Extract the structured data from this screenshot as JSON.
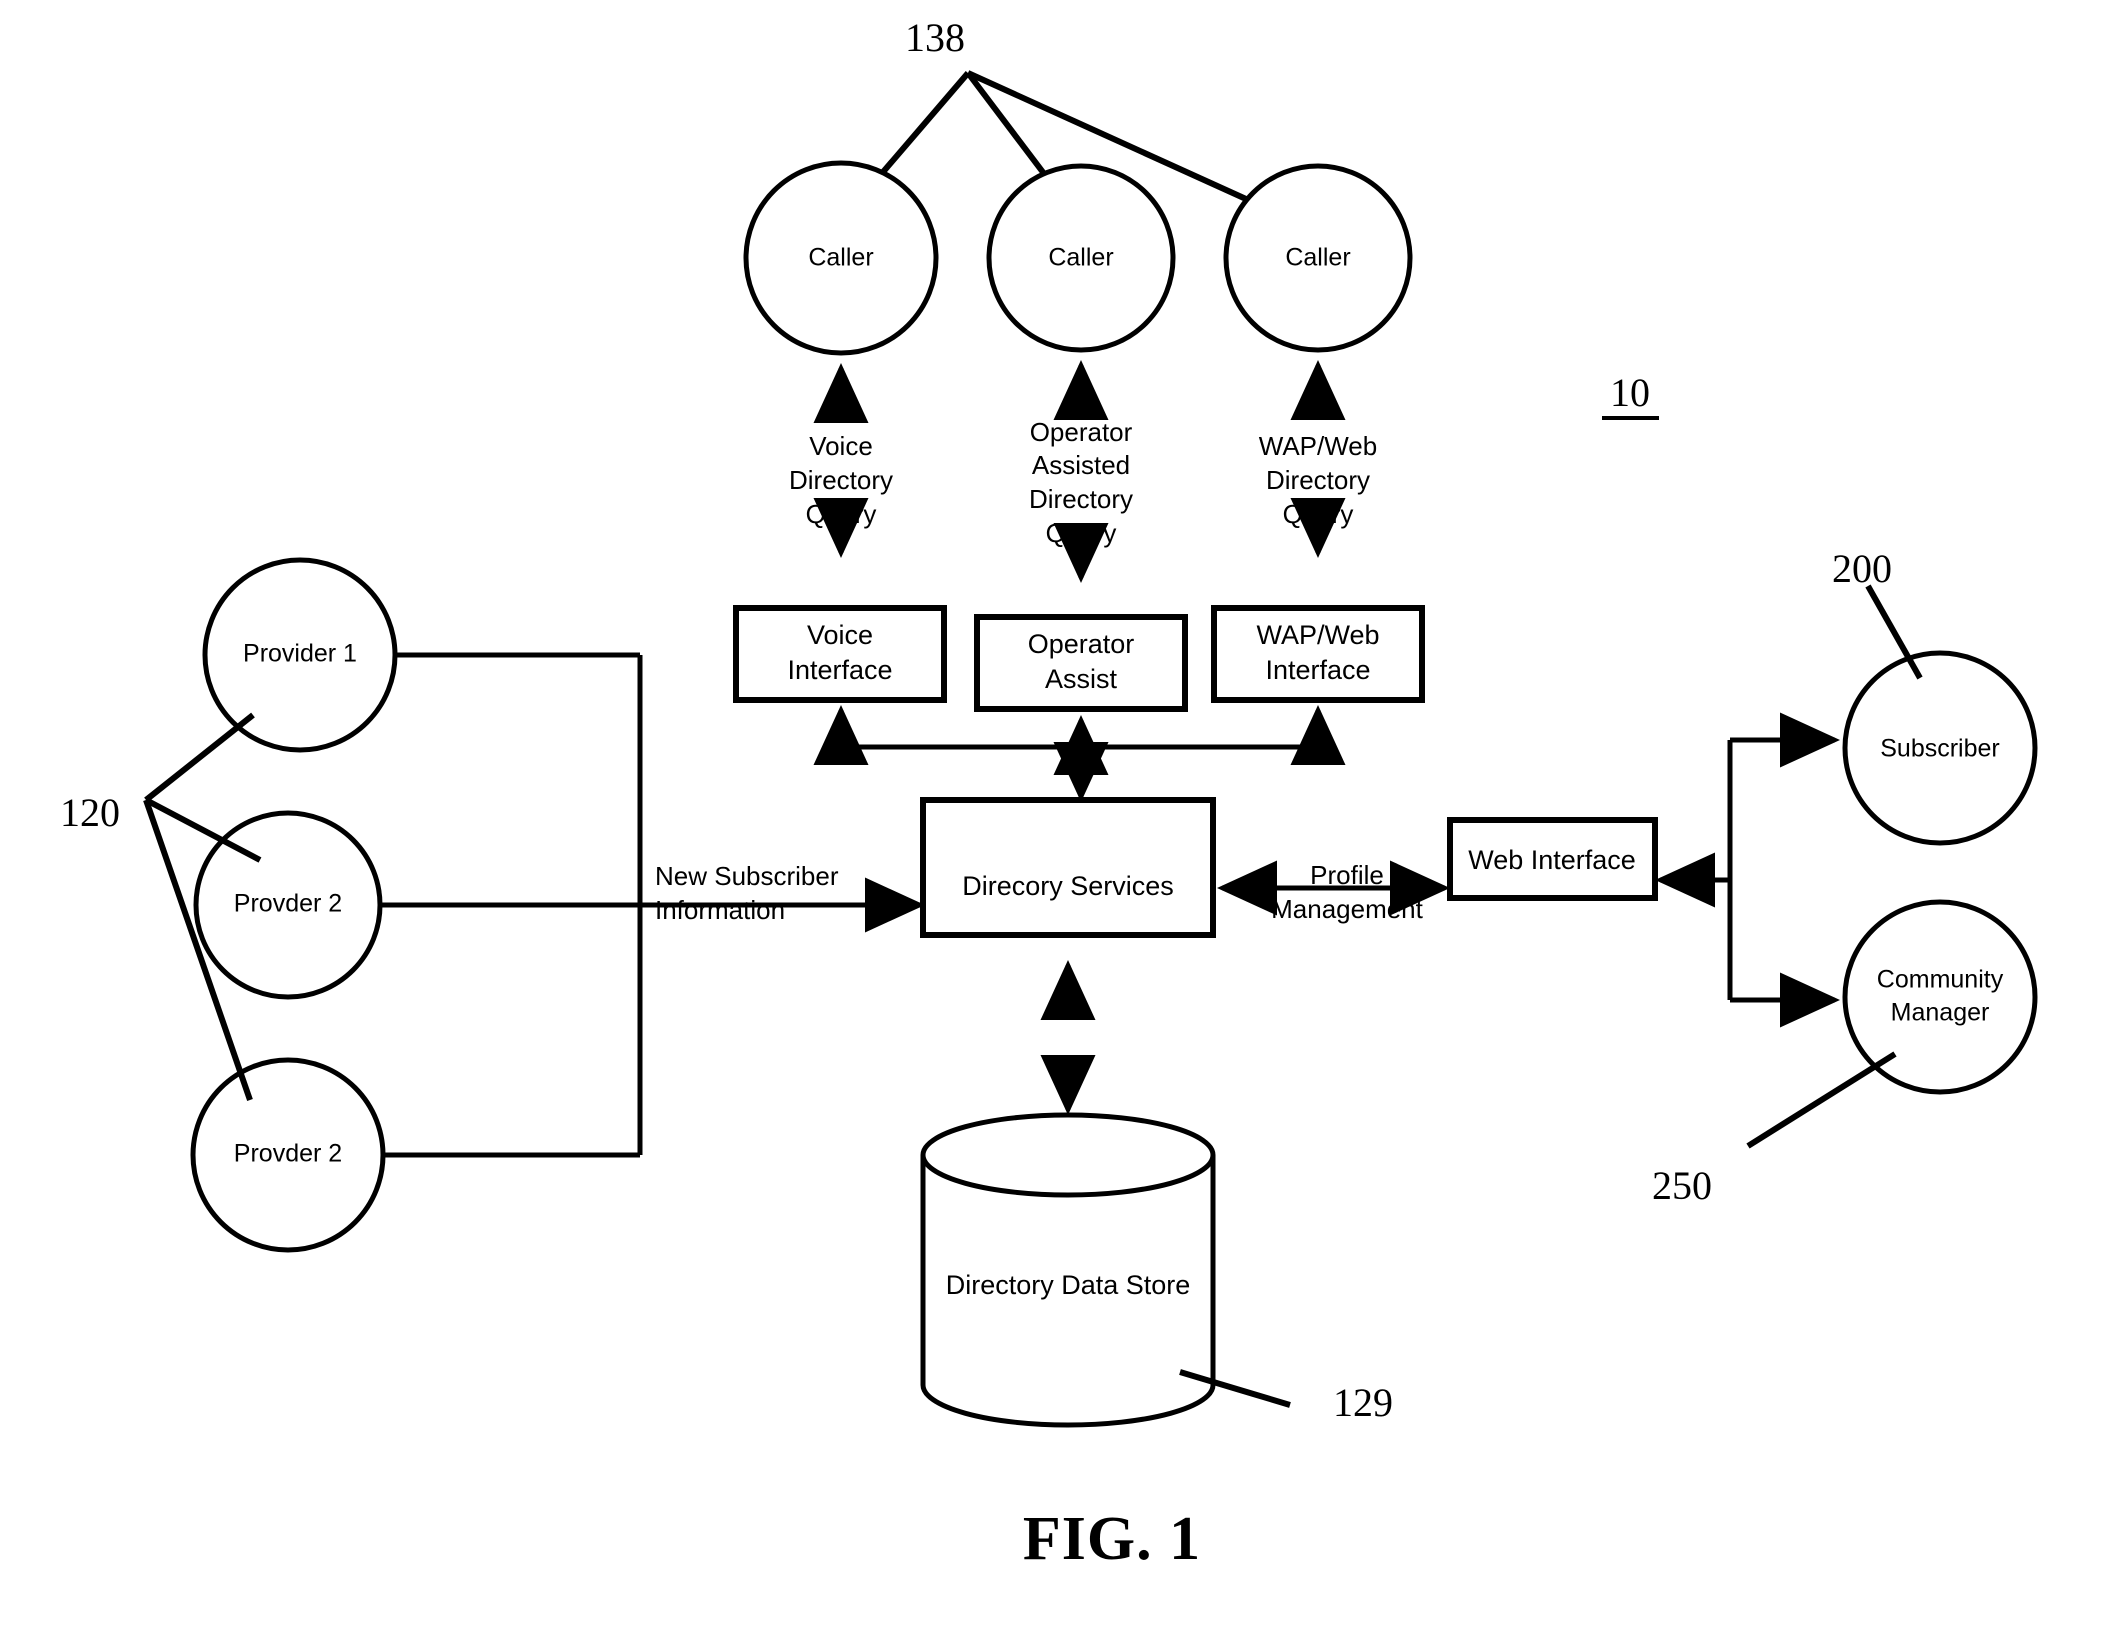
{
  "figure": {
    "caption": "FIG. 1",
    "system_ref": "10"
  },
  "reference_numerals": {
    "callers": "138",
    "providers": "120",
    "system": "10",
    "data_store": "129",
    "subscriber": "200",
    "community_manager": "250"
  },
  "callers": [
    {
      "label": "Caller"
    },
    {
      "label": "Caller"
    },
    {
      "label": "Caller"
    }
  ],
  "query_labels": [
    {
      "lines": [
        "Voice",
        "Directory",
        "Query"
      ]
    },
    {
      "lines": [
        "Operator",
        "Assisted",
        "Directory",
        "Query"
      ]
    },
    {
      "lines": [
        "WAP/Web",
        "Directory",
        "Query"
      ]
    }
  ],
  "interfaces": [
    {
      "lines": [
        "Voice",
        "Interface"
      ]
    },
    {
      "lines": [
        "Operator",
        "Assist"
      ]
    },
    {
      "lines": [
        "WAP/Web",
        "Interface"
      ]
    }
  ],
  "core": {
    "directory_services": "Direcory Services",
    "data_store": "Directory Data Store"
  },
  "providers": [
    {
      "label": "Provider 1"
    },
    {
      "label": "Provder 2"
    },
    {
      "label": "Provder 2"
    }
  ],
  "edges": {
    "new_subscriber": [
      "New Subscriber",
      "Information"
    ],
    "profile_management": [
      "Profile",
      "Management"
    ]
  },
  "right_side": {
    "web_interface": "Web Interface",
    "subscriber": "Subscriber",
    "community_manager": [
      "Community",
      "Manager"
    ]
  },
  "colors": {
    "ink": "#000000",
    "paper": "#ffffff"
  }
}
